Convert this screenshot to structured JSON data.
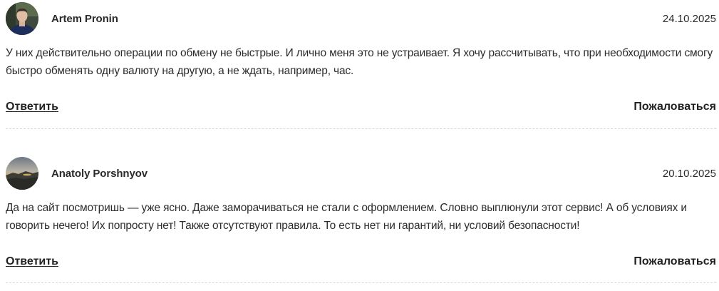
{
  "comments": [
    {
      "author": "Artem Pronin",
      "date": "24.10.2025",
      "text": "У них действительно операции по обмену не быстрые. И лично меня это не устраивает. Я хочу рассчитывать, что при необходимости смогу быстро обменять одну валюту на другую, а не ждать, например, час.",
      "reply_label": "Ответить",
      "report_label": "Пожаловаться",
      "avatar_icon": "person-photo-avatar"
    },
    {
      "author": "Anatoly Porshnyov",
      "date": "20.10.2025",
      "text": "Да на сайт посмотришь — уже ясно. Даже заморачиваться не стали с оформлением. Словно выплюнули этот сервис! А об условиях и говорить нечего! Их попросту нет! Также отсутствуют правила. То есть нет ни гарантий, ни условий безопасности!",
      "reply_label": "Ответить",
      "report_label": "Пожаловаться",
      "avatar_icon": "landscape-photo-avatar"
    }
  ]
}
